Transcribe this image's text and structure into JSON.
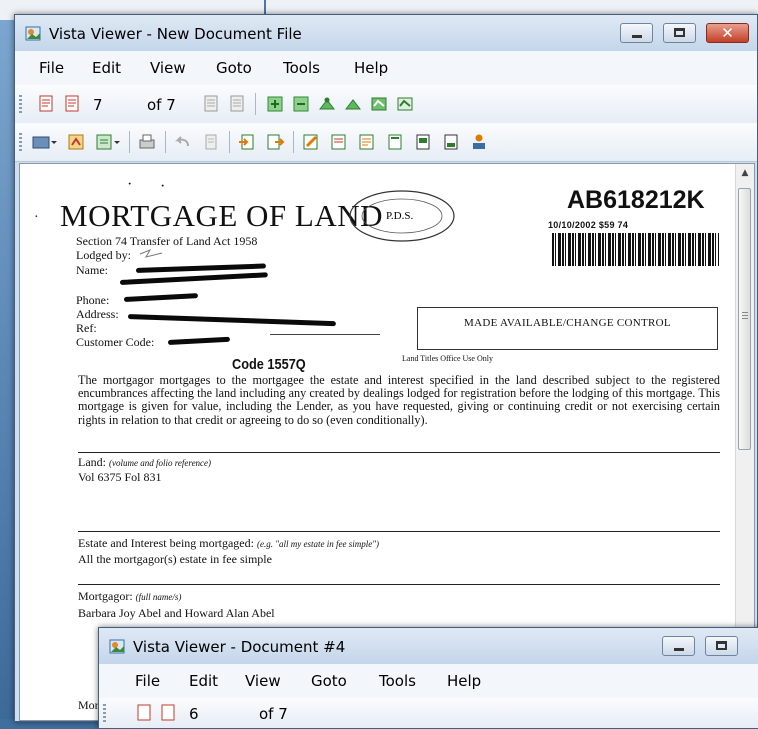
{
  "main_window": {
    "title": "Vista Viewer - New Document File",
    "menu": [
      "File",
      "Edit",
      "View",
      "Goto",
      "Tools",
      "Help"
    ],
    "page_current": "7",
    "page_total": "of 7",
    "toolbar1_icons": [
      "first-page-icon",
      "previous-page-icon",
      "page-back-icon",
      "page-forward-icon",
      "rotate-left-icon",
      "rotate-right-icon",
      "zoom-in-icon",
      "zoom-out-icon",
      "fit-page-icon",
      "fit-width-icon"
    ],
    "toolbar2_icons": [
      "folder-icon",
      "scan-icon",
      "copy-icon",
      "print-icon",
      "undo-icon",
      "stamp-icon",
      "import-icon",
      "export-icon",
      "edit-icon",
      "annotate-icon",
      "note-icon",
      "document-icon",
      "page-icon",
      "save-icon",
      "user-icon"
    ]
  },
  "document": {
    "title": "MORTGAGE OF LAND",
    "subtitle": "Section 74 Transfer of Land Act 1958",
    "lodged_by": "Lodged by:",
    "name_label": "Name:",
    "phone_label": "Phone:",
    "address_label": "Address:",
    "ref_label": "Ref:",
    "customer_code_label": "Customer Code:",
    "code_handwritten": "Code 1557Q",
    "stamp_text": "P.D.S.",
    "doc_number": "AB618212K",
    "doc_date": "10/10/2002  $59           74",
    "made_available": "MADE AVAILABLE/CHANGE CONTROL",
    "ltouo": "Land Titles Office Use Only",
    "paragraph": "The mortgagor mortgages to the mortgagee the estate and interest specified in the land described subject to the registered encumbrances affecting the land including any created by dealings lodged for registration before the lodging of this mortgage. This mortgage is given for value, including the Lender, as you have requested, giving or continuing credit or not exercising certain rights in relation to that credit or agreeing to do so (even conditionally).",
    "land_label": "Land:",
    "land_hint": "(volume and folio reference)",
    "land_value": "Vol 6375 Fol 831",
    "estate_label": "Estate and Interest being mortgaged:",
    "estate_hint": "(e.g. \"all my estate in fee simple\")",
    "estate_value": "All the mortgagor(s) estate in fee simple",
    "mortgagor_label": "Mortgagor:",
    "mortgagor_hint": "(full name/s)",
    "mortgagor_value": "Barbara Joy Abel and Howard Alan Abel",
    "mortgagee_partial": "Mor"
  },
  "second_window": {
    "title": "Vista Viewer - Document #4",
    "menu": [
      "File",
      "Edit",
      "View",
      "Goto",
      "Tools",
      "Help"
    ],
    "page_current": "6",
    "page_total": "of 7"
  }
}
